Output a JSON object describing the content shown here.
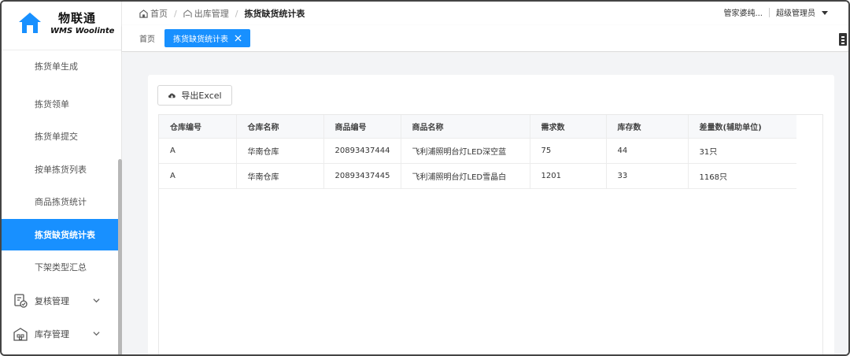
{
  "app": {
    "logo_cn": "物联通",
    "logo_en": "WMS Woolinte"
  },
  "sidebar": {
    "items": [
      {
        "label": "拣货单生成"
      },
      {
        "label": "拣货领单"
      },
      {
        "label": "拣货单提交"
      },
      {
        "label": "按单拣货列表"
      },
      {
        "label": "商品拣货统计"
      },
      {
        "label": "拣货缺货统计表",
        "active": true
      },
      {
        "label": "下架类型汇总"
      }
    ],
    "groups": [
      {
        "label": "复核管理",
        "icon": "review-icon"
      },
      {
        "label": "库存管理",
        "icon": "warehouse-icon"
      }
    ]
  },
  "header": {
    "breadcrumb": [
      {
        "label": "首页",
        "icon": "home-icon"
      },
      {
        "label": "出库管理",
        "icon": "warehouse-out-icon"
      },
      {
        "label": "拣货缺货统计表"
      }
    ],
    "org": "管家婆纯...",
    "user": "超级管理员"
  },
  "tabs": [
    {
      "label": "首页"
    },
    {
      "label": "拣货缺货统计表",
      "active": true
    }
  ],
  "toolbar": {
    "export_label": "导出Excel"
  },
  "table": {
    "columns": [
      "仓库编号",
      "仓库名称",
      "商品编号",
      "商品名称",
      "需求数",
      "库存数",
      "差量数(辅助单位)"
    ],
    "rows": [
      [
        "A",
        "华南仓库",
        "20893437444",
        "飞利浦照明台灯LED深空蓝",
        "75",
        "44",
        "31只"
      ],
      [
        "A",
        "华南仓库",
        "20893437445",
        "飞利浦照明台灯LED雪晶白",
        "1201",
        "33",
        "1168只"
      ]
    ]
  },
  "colors": {
    "accent": "#1890ff",
    "content_bg": "#f3f4f6"
  }
}
